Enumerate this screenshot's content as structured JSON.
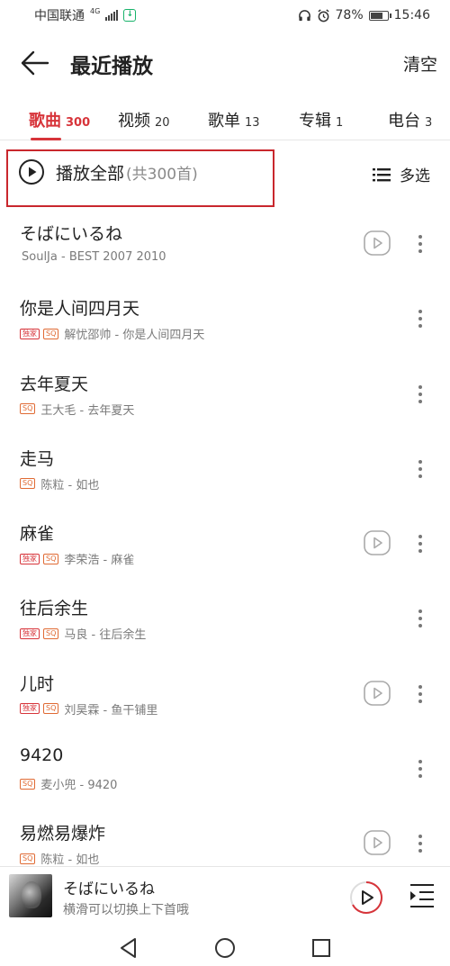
{
  "status_bar": {
    "carrier": "中国联通",
    "network": "4G",
    "battery": "78%",
    "battery_level": 0.78,
    "time": "15:46"
  },
  "header": {
    "title": "最近播放",
    "clear_label": "清空"
  },
  "tabs": [
    {
      "label": "歌曲",
      "count": "300",
      "active": true
    },
    {
      "label": "视频",
      "count": "20"
    },
    {
      "label": "歌单",
      "count": "13"
    },
    {
      "label": "专辑",
      "count": "1"
    },
    {
      "label": "电台",
      "count": "3"
    }
  ],
  "play_all": {
    "label": "播放全部",
    "count": "(共300首)",
    "multi_select_label": "多选"
  },
  "songs": [
    {
      "title": "そばにいるね",
      "subtitle": "SoulJa - BEST 2007 2010",
      "has_video": true
    },
    {
      "title": "你是人间四月天",
      "subtitle": "解忧邵帅 - 你是人间四月天",
      "exclusive": true,
      "sq": true
    },
    {
      "title": "去年夏天",
      "subtitle": "王大毛 - 去年夏天",
      "sq": true
    },
    {
      "title": "走马",
      "subtitle": "陈粒 - 如也",
      "sq": true
    },
    {
      "title": "麻雀",
      "subtitle": "李荣浩 - 麻雀",
      "exclusive": true,
      "sq": true,
      "has_video": true
    },
    {
      "title": "往后余生",
      "subtitle": "马良 - 往后余生",
      "exclusive": true,
      "sq": true
    },
    {
      "title": "儿时",
      "subtitle": "刘昊霖 - 鱼干铺里",
      "exclusive": true,
      "sq": true,
      "has_video": true
    },
    {
      "title": "9420",
      "subtitle": "麦小兜 - 9420",
      "sq": true
    },
    {
      "title": "易燃易爆炸",
      "subtitle": "陈粒 - 如也",
      "sq": true,
      "has_video": true
    }
  ],
  "badges": {
    "exclusive": "独家",
    "sq": "SQ"
  },
  "mini_player": {
    "title": "そばにいるね",
    "hint": "横滑可以切换上下首哦"
  },
  "colors": {
    "accent": "#d7343a",
    "highlight_box": "#c9272d",
    "sq_badge": "#e06a33"
  }
}
